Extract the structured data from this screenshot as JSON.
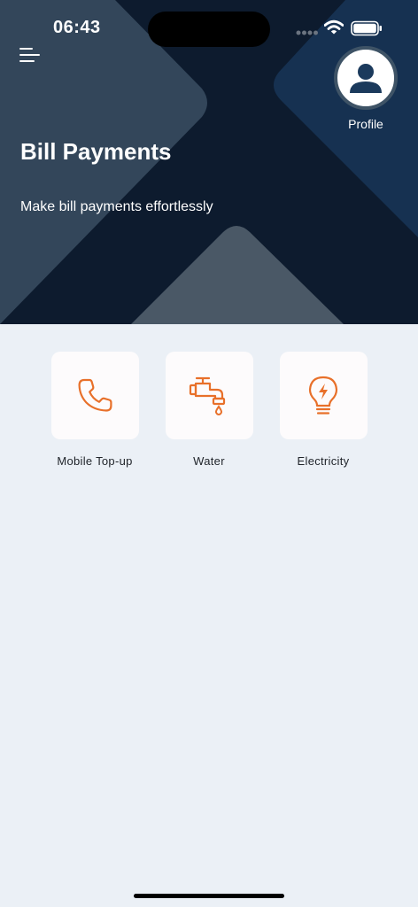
{
  "status_bar": {
    "time": "06:43"
  },
  "header": {
    "title": "Bill Payments",
    "subtitle": "Make bill payments effortlessly",
    "profile_label": "Profile",
    "menu_icon": "menu-icon",
    "profile_icon": "user-icon"
  },
  "services": [
    {
      "label": "Mobile Top-up",
      "icon": "phone-icon"
    },
    {
      "label": "Water",
      "icon": "faucet-icon"
    },
    {
      "label": "Electricity",
      "icon": "lightbulb-icon"
    }
  ],
  "colors": {
    "header_bg": "#0d1b2e",
    "page_bg": "#ebf0f6",
    "accent": "#e8702a",
    "avatar_icon": "#1b3a5c",
    "card_bg": "#fdfbfc"
  }
}
